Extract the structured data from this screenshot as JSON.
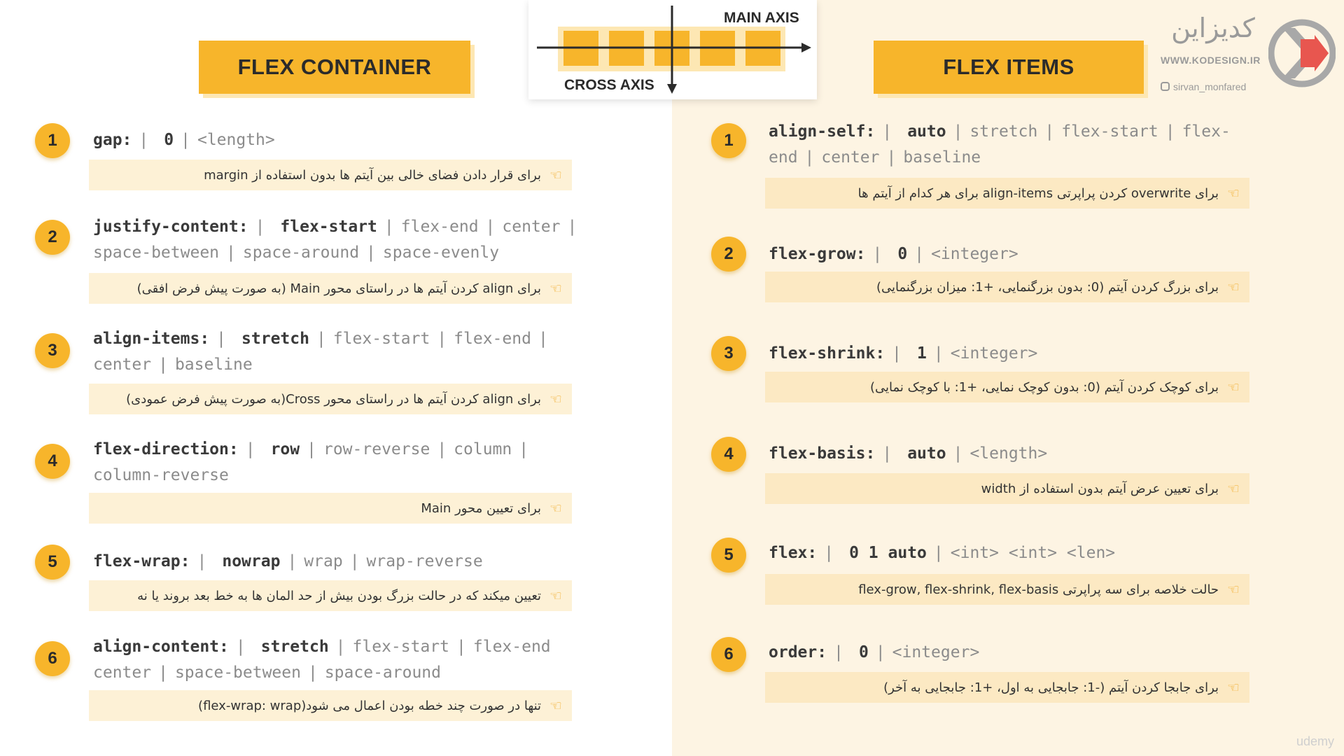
{
  "axis_diagram": {
    "main_axis_label": "MAIN AXIS",
    "cross_axis_label": "CROSS AXIS",
    "colors": {
      "box": "#f7b52b",
      "track": "#fde7b3",
      "axis": "#2b2b2b"
    }
  },
  "flex_container": {
    "title": "FLEX CONTAINER",
    "items": [
      {
        "number": "1",
        "lines": [
          [
            "gap:",
            "0",
            "<length>"
          ]
        ],
        "description": "برای قرار دادن فضای خالی بین آیتم ها بدون استفاده از margin"
      },
      {
        "number": "2",
        "lines": [
          [
            "justify-content:",
            "flex-start",
            "flex-end",
            "center",
            ""
          ],
          [
            "space-between",
            "space-around",
            "space-evenly"
          ]
        ],
        "description": "برای align کردن آیتم ها در راستای محور Main (به صورت پیش فرض افقی)"
      },
      {
        "number": "3",
        "lines": [
          [
            "align-items:",
            "stretch",
            "flex-start",
            "flex-end",
            ""
          ],
          [
            "center",
            "baseline"
          ]
        ],
        "description": "برای align کردن آیتم ها در راستای محور Cross(به صورت پیش فرض عمودی)"
      },
      {
        "number": "4",
        "lines": [
          [
            "flex-direction:",
            "row",
            "row-reverse",
            "column",
            ""
          ],
          [
            "column-reverse"
          ]
        ],
        "description": "برای تعیین محور Main"
      },
      {
        "number": "5",
        "lines": [
          [
            "flex-wrap:",
            "nowrap",
            "wrap",
            "wrap-reverse"
          ]
        ],
        "description": "تعیین میکند که در حالت بزرگ بودن بیش از حد المان ها به خط بعد بروند یا نه"
      },
      {
        "number": "6",
        "lines": [
          [
            "align-content:",
            "stretch",
            "flex-start",
            "flex-end"
          ],
          [
            "center",
            "space-between",
            "space-around"
          ]
        ],
        "description": "تنها در صورت چند خطه بودن اعمال می شود(flex-wrap: wrap)"
      }
    ]
  },
  "flex_items": {
    "title": "FLEX ITEMS",
    "items": [
      {
        "number": "1",
        "lines": [
          [
            "align-self:",
            "auto",
            "stretch",
            "flex-start",
            "flex-"
          ],
          [
            "end",
            "center",
            "baseline"
          ]
        ],
        "description": "برای overwrite کردن پراپرتی align-items برای هر کدام از آیتم ها"
      },
      {
        "number": "2",
        "lines": [
          [
            "flex-grow:",
            "0",
            "<integer>"
          ]
        ],
        "description": "برای بزرگ کردن آیتم (0: بدون بزرگنمایی، +1: میزان بزرگنمایی)"
      },
      {
        "number": "3",
        "lines": [
          [
            "flex-shrink:",
            "1",
            "<integer>"
          ]
        ],
        "description": "برای کوچک کردن آیتم (0: بدون کوچک نمایی، +1: با کوچک نمایی)"
      },
      {
        "number": "4",
        "lines": [
          [
            "flex-basis:",
            "auto",
            "<length>"
          ]
        ],
        "description": "برای تعیین عرض آیتم بدون استفاده از width"
      },
      {
        "number": "5",
        "lines": [
          [
            "flex:",
            "0 1 auto",
            "<int> <int> <len>"
          ]
        ],
        "description": "حالت خلاصه برای سه پراپرتی flex-grow, flex-shrink, flex-basis"
      },
      {
        "number": "6",
        "lines": [
          [
            "order:",
            "0",
            "<integer>"
          ]
        ],
        "description": "برای جابجا کردن آیتم (-1: جابجایی به اول، +1: جابجایی به آخر)"
      }
    ]
  },
  "logo": {
    "brand": "کدیزاین",
    "url": "WWW.KODESIGN.IR",
    "instagram": "sirvan_monfared",
    "mark_icon": "kodesign-logo-icon",
    "colors": {
      "red": "#e8564f",
      "gray": "#a8a8a8"
    }
  },
  "watermark": "udemy",
  "colors": {
    "accent": "#f7b52b",
    "left_bg": "#ffffff",
    "right_bg": "#fdf4e3",
    "desc_bg_left": "#fdf1d6",
    "desc_bg_right": "#fce9c3"
  }
}
